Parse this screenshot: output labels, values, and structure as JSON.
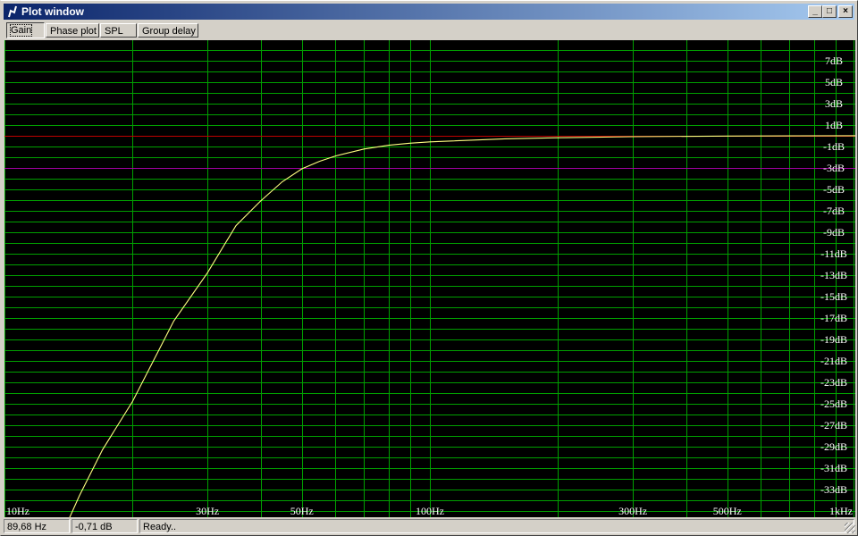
{
  "window": {
    "title": "Plot window",
    "buttons": {
      "minimize": "_",
      "maximize": "□",
      "close": "×"
    }
  },
  "tabs": [
    {
      "label": "Gain",
      "selected": true
    },
    {
      "label": "Phase plot"
    },
    {
      "label": "SPL"
    },
    {
      "label": "Group delay"
    }
  ],
  "status": {
    "frequency": "89,68 Hz",
    "gain": "-0,71 dB",
    "message": "Ready.."
  },
  "colors": {
    "background": "#000000",
    "grid": "#00a000",
    "curve": "#ffff80",
    "zero_line": "#c00000",
    "minus3_line": "#a000a0"
  },
  "chart_data": {
    "type": "line",
    "title": "Gain",
    "xscale": "log",
    "xlim": [
      10,
      1000
    ],
    "ylim": [
      -35.6,
      8.9
    ],
    "x_ticks": [
      {
        "value": 10,
        "label": "10Hz"
      },
      {
        "value": 30,
        "label": "30Hz"
      },
      {
        "value": 50,
        "label": "50Hz"
      },
      {
        "value": 100,
        "label": "100Hz"
      },
      {
        "value": 300,
        "label": "300Hz"
      },
      {
        "value": 500,
        "label": "500Hz"
      },
      {
        "value": 1000,
        "label": "1kHz"
      }
    ],
    "y_ticks": [
      {
        "value": 7,
        "label": "7dB"
      },
      {
        "value": 5,
        "label": "5dB"
      },
      {
        "value": 3,
        "label": "3dB"
      },
      {
        "value": 1,
        "label": "1dB"
      },
      {
        "value": -1,
        "label": "-1dB"
      },
      {
        "value": -3,
        "label": "-3dB"
      },
      {
        "value": -5,
        "label": "-5dB"
      },
      {
        "value": -7,
        "label": "-7dB"
      },
      {
        "value": -9,
        "label": "-9dB"
      },
      {
        "value": -11,
        "label": "-11dB"
      },
      {
        "value": -13,
        "label": "-13dB"
      },
      {
        "value": -15,
        "label": "-15dB"
      },
      {
        "value": -17,
        "label": "-17dB"
      },
      {
        "value": -19,
        "label": "-19dB"
      },
      {
        "value": -21,
        "label": "-21dB"
      },
      {
        "value": -23,
        "label": "-23dB"
      },
      {
        "value": -25,
        "label": "-25dB"
      },
      {
        "value": -27,
        "label": "-27dB"
      },
      {
        "value": -29,
        "label": "-29dB"
      },
      {
        "value": -31,
        "label": "-31dB"
      },
      {
        "value": -33,
        "label": "-33dB"
      }
    ],
    "grid": true,
    "reference_lines": [
      {
        "value": 0,
        "color": "#c00000"
      },
      {
        "value": -3,
        "color": "#a000a0"
      }
    ],
    "series": [
      {
        "name": "Gain",
        "x": [
          14.2,
          15,
          17,
          20,
          25,
          30,
          35,
          40,
          45,
          50,
          55,
          60,
          70,
          80,
          89.68,
          100,
          150,
          200,
          300,
          500,
          1000
        ],
        "y": [
          -35.7,
          -33.6,
          -29.3,
          -24.8,
          -17.3,
          -12.8,
          -8.4,
          -6.1,
          -4.3,
          -3.1,
          -2.4,
          -1.9,
          -1.25,
          -0.9,
          -0.71,
          -0.58,
          -0.3,
          -0.2,
          -0.1,
          -0.04,
          -0.01
        ]
      }
    ]
  }
}
